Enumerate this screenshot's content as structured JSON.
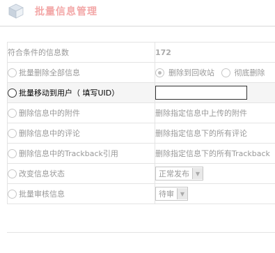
{
  "header": {
    "title": "批量信息管理"
  },
  "rows": {
    "count": {
      "label": "符合条件的信息数",
      "value": "172"
    },
    "delete_all": {
      "label": "批量删除全部信息",
      "opt_recycle": "删除到回收站",
      "opt_permanent": "彻底删除"
    },
    "move_to_user": {
      "label": "批量移动到用户（ 填写UID）",
      "input_value": ""
    },
    "delete_attachments": {
      "label": "删除信息中的附件",
      "desc": "删除指定信息中上传的附件"
    },
    "delete_comments": {
      "label": "删除信息中的评论",
      "desc": "删除指定信息下的所有评论"
    },
    "delete_trackback": {
      "label": "删除信息中的Trackback引用",
      "desc": "删除指定信息下的所有Trackback"
    },
    "change_status": {
      "label": "改变信息状态",
      "select_value": "正常发布"
    },
    "batch_review": {
      "label": "批量审核信息",
      "select_value": "待审"
    }
  }
}
